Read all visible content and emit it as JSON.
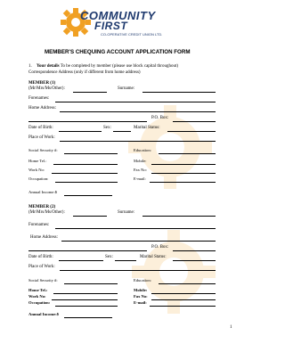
{
  "logo": {
    "name_line1": "COMMUNITY",
    "name_line2": "FIRST",
    "tagline": "CO-OPERATIVE CREDIT UNION LTD."
  },
  "form_title": "MEMBER'S CHEQUING ACCOUNT APPLICATION FORM",
  "intro": {
    "number": "1.",
    "heading": "Your details",
    "text1": "To be completed by member (please use block capital throughout)",
    "text2": "Correspondence Address (only if different from home address)"
  },
  "member1": {
    "heading": "MEMBER (1)",
    "title": "(Mr/Mrs/Ms/Other):",
    "surname": "Surname:",
    "forenames": "Forenames:",
    "home_address": "Home Address:",
    "po_box": "P.O. Box:",
    "dob": "Date of Birth:",
    "sex": "Sex:",
    "marital": "Marital Status:",
    "place_of_work": "Place of Work:",
    "ssn": "Social Security #:",
    "education": "Education:",
    "home_tel": "Home Tel.:",
    "mobile": "Mobile:",
    "work_no": "Work No:",
    "fax_no": "Fax No:",
    "occupation": "Occupation:",
    "email": "E-mail:",
    "annual_income": "Annual Income:$"
  },
  "member2": {
    "heading": "MEMBER (2)",
    "title": "(Mr/Mrs/Ms/Other):",
    "surname": "Surname:",
    "forenames": "Forenames:",
    "home_address": "Home Address:",
    "po_box": "P.O. Box:",
    "dob": "Date of Birth:",
    "sex": "Sex:",
    "marital": "Marital Status:",
    "place_of_work": "Place of Work:",
    "ssn": "Social Security #:",
    "education": "Education:",
    "home_tel": "Home Tel.:",
    "mobile": "Mobile:",
    "work_no": "Work No:",
    "fax_no": "Fax No:",
    "occupation": "Occupation:",
    "email": "E-mail:",
    "annual_income": "Annual Income:$"
  },
  "page_number": "1",
  "colors": {
    "logo_navy": "#1f3a6e",
    "logo_orange": "#f0a023"
  }
}
